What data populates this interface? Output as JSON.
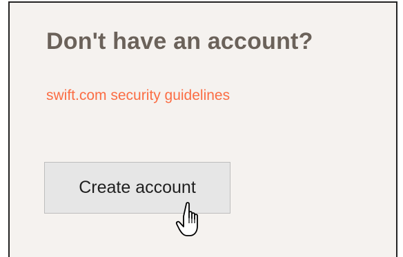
{
  "signup_panel": {
    "title": "Don't have an account?",
    "guidelines_link": "swift.com security guidelines",
    "create_account_label": "Create account"
  },
  "colors": {
    "panel_background": "#f5f2ef",
    "title_text": "#6b625a",
    "link_text": "#fb6d44",
    "button_background": "#e6e6e6"
  },
  "icons": {
    "cursor": "hand-pointer-icon"
  }
}
